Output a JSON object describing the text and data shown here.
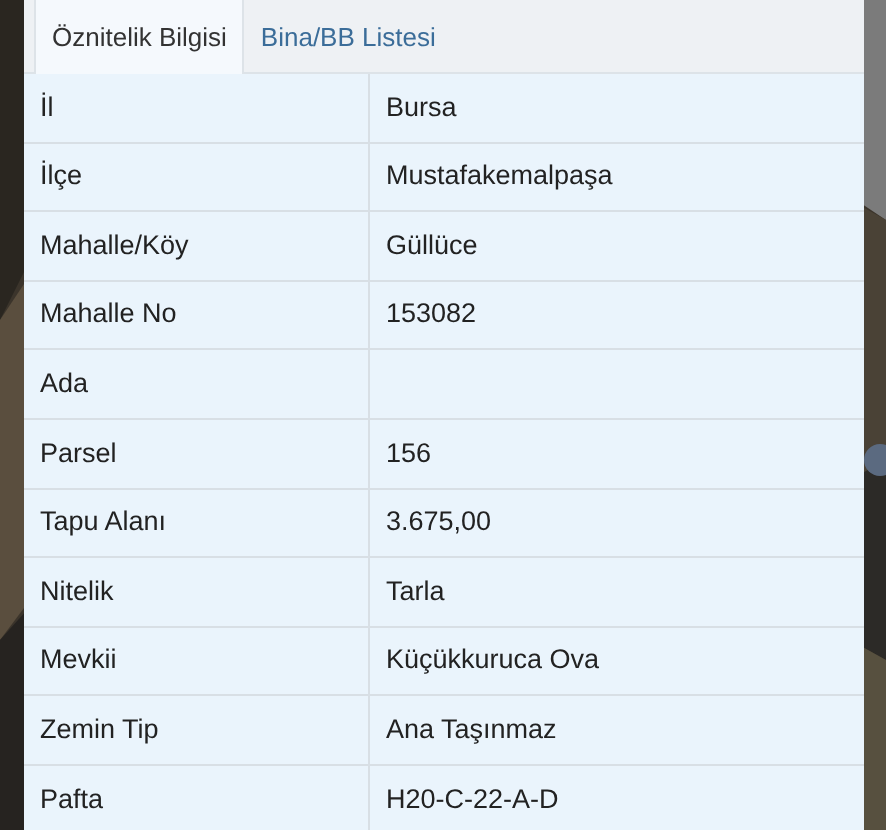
{
  "tabs": [
    {
      "label": "Öznitelik Bilgisi",
      "selected": true
    },
    {
      "label": "Bina/BB Listesi",
      "selected": false
    }
  ],
  "rows": [
    {
      "label": "İl",
      "value": "Bursa"
    },
    {
      "label": "İlçe",
      "value": "Mustafakemalpaşa"
    },
    {
      "label": "Mahalle/Köy",
      "value": "Güllüce"
    },
    {
      "label": "Mahalle No",
      "value": "153082"
    },
    {
      "label": "Ada",
      "value": ""
    },
    {
      "label": "Parsel",
      "value": "156"
    },
    {
      "label": "Tapu Alanı",
      "value": "3.675,00"
    },
    {
      "label": "Nitelik",
      "value": "Tarla"
    },
    {
      "label": "Mevkii",
      "value": "Küçükkuruca Ova"
    },
    {
      "label": "Zemin Tip",
      "value": "Ana Taşınmaz"
    },
    {
      "label": "Pafta",
      "value": "H20-C-22-A-D"
    }
  ]
}
